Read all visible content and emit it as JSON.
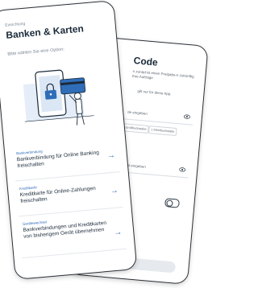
{
  "front": {
    "breadcrumb": "Einrichtung",
    "title": "Banken & Karten",
    "prompt": "Bitte wählen Sie eine Option:",
    "options": [
      {
        "category": "Bankverbindung",
        "label": "Bankverbindung für Online Banking freischalten"
      },
      {
        "category": "Kreditkarte",
        "label": "Kreditkarte für Online-Zahlungen freischalten"
      },
      {
        "category": "Gerätewechsel",
        "label": "Bankverbindungen und Kreditkarten von bisherigem Gerät übernehmen"
      }
    ]
  },
  "back": {
    "title": "Code",
    "intro": "n zunächst einen Freigabe-n zukünftig Ihre Aufträge",
    "note": "gilt nur für diese App.",
    "field1": "de eingeben",
    "chips": [
      "Großbuchstabe",
      "1 Kleinbuchstabe"
    ],
    "field2": "neut eingeben",
    "toggle_label": "en",
    "button": "Weiter"
  },
  "colors": {
    "accent": "#2f6db8",
    "text": "#1b2a3a",
    "frame": "#2a2f36"
  }
}
